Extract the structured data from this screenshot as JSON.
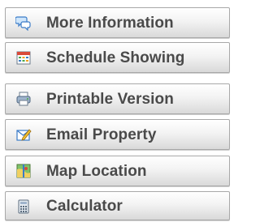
{
  "menu": {
    "items": [
      {
        "label": "More Information",
        "icon": "speech-bubbles-icon"
      },
      {
        "label": "Schedule Showing",
        "icon": "calendar-icon"
      },
      {
        "label": "Printable Version",
        "icon": "printer-icon"
      },
      {
        "label": "Email Property",
        "icon": "email-pencil-icon"
      },
      {
        "label": "Map Location",
        "icon": "map-icon"
      },
      {
        "label": "Calculator",
        "icon": "calculator-icon"
      }
    ]
  }
}
